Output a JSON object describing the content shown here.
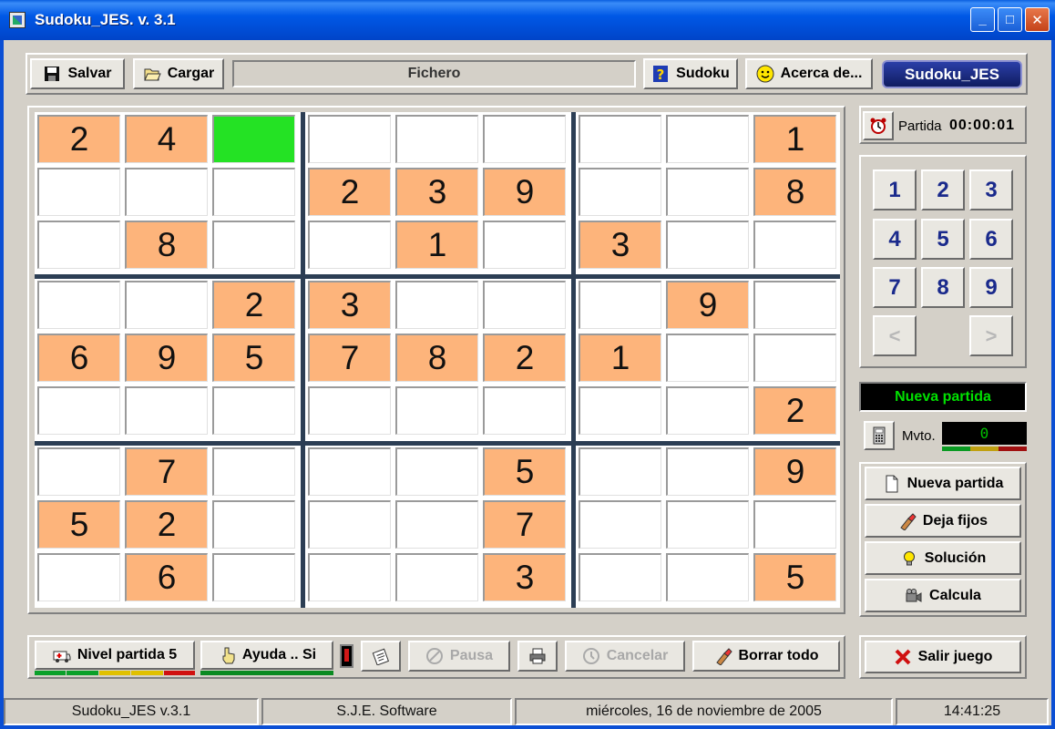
{
  "window": {
    "title": "Sudoku_JES. v. 3.1",
    "minimize": "_",
    "maximize": "□",
    "close": "✕"
  },
  "toolbar": {
    "save_label": "Salvar",
    "load_label": "Cargar",
    "file_label": "Fichero",
    "sudoku_label": "Sudoku",
    "about_label": "Acerca de...",
    "brand_label": "Sudoku_JES"
  },
  "board": {
    "rows": [
      [
        "2",
        "4",
        "",
        "",
        "",
        "",
        "",
        "",
        "1"
      ],
      [
        "",
        "",
        "",
        "2",
        "3",
        "9",
        "",
        "",
        "8"
      ],
      [
        "",
        "8",
        "",
        "",
        "1",
        "",
        "3",
        "",
        ""
      ],
      [
        "",
        "",
        "2",
        "3",
        "",
        "",
        "",
        "9",
        ""
      ],
      [
        "6",
        "9",
        "5",
        "7",
        "8",
        "2",
        "1",
        "",
        ""
      ],
      [
        "",
        "",
        "",
        "",
        "",
        "",
        "",
        "",
        "2"
      ],
      [
        "",
        "7",
        "",
        "",
        "",
        "5",
        "",
        "",
        "9"
      ],
      [
        "5",
        "2",
        "",
        "",
        "",
        "7",
        "",
        "",
        ""
      ],
      [
        "",
        "6",
        "",
        "",
        "",
        "3",
        "",
        "",
        "5"
      ]
    ],
    "selected": [
      0,
      2
    ]
  },
  "timer": {
    "label": "Partida",
    "value": "00:00:01"
  },
  "keypad": {
    "keys": [
      "1",
      "2",
      "3",
      "4",
      "5",
      "6",
      "7",
      "8",
      "9"
    ],
    "prev": "<",
    "next": ">"
  },
  "status": {
    "message": "Nueva partida"
  },
  "moves": {
    "label": "Mvto.",
    "value": "0"
  },
  "actions": {
    "new_game": "Nueva partida",
    "keep_fixed": "Deja fijos",
    "solution": "Solución",
    "calculate": "Calcula",
    "exit": "Salir juego"
  },
  "bottom": {
    "level": "Nivel partida 5",
    "help": "Ayuda .. Si",
    "pause": "Pausa",
    "cancel": "Cancelar",
    "clear_all": "Borrar todo"
  },
  "statusbar": {
    "app": "Sudoku_JES  v.3.1",
    "company": "S.J.E. Software",
    "date": "miércoles, 16 de noviembre de 2005",
    "time": "14:41:25"
  },
  "colors": {
    "given": "#fdb47b",
    "selected": "#24e224",
    "board_divider": "#2c3e54",
    "title_bar": "#0054e3"
  }
}
